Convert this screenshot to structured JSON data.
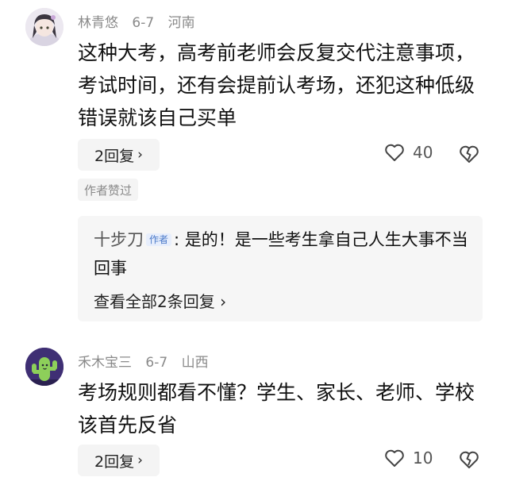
{
  "comments": [
    {
      "username": "林青悠",
      "date": "6-7",
      "location": "河南",
      "text": "这种大考，高考前老师会反复交代注意事项，考试时间，还有会提前认考场，还犯这种低级错误就该自己买单",
      "reply_label": "2回复",
      "like_count": "40",
      "author_liked": "作者赞过",
      "sub_reply": {
        "author": "十步刀",
        "badge": "作者",
        "text": ": 是的！是一些考生拿自己人生大事不当回事"
      },
      "view_all": "查看全部2条回复"
    },
    {
      "username": "禾木宝三",
      "date": "6-7",
      "location": "山西",
      "text": "考场规则都看不懂？学生、家长、老师、学校该首先反省",
      "reply_label": "2回复",
      "like_count": "10"
    }
  ],
  "icons": {
    "like": "heart-outline-icon",
    "dislike": "broken-heart-icon",
    "chevron": "chevron-right-icon"
  }
}
